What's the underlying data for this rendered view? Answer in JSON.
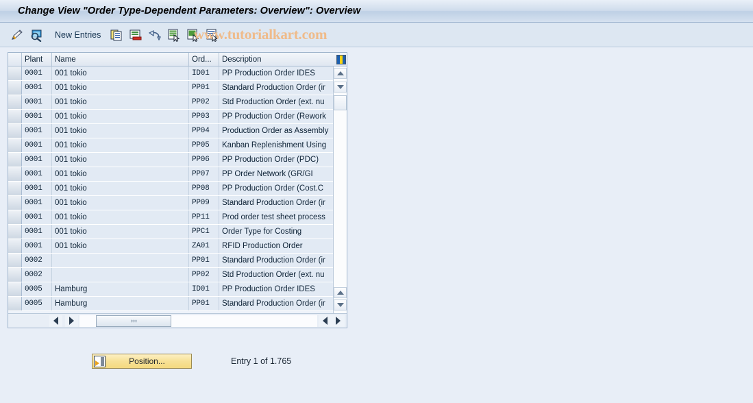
{
  "window": {
    "title": "Change View \"Order Type-Dependent Parameters: Overview\": Overview"
  },
  "watermark": {
    "text": "www.tutorialkart.com",
    "color": "#efbb8a"
  },
  "toolbar": {
    "new_entries_label": "New Entries",
    "icons": [
      {
        "name": "display-change-pencil-icon",
        "title": "Display/Change"
      },
      {
        "name": "check-entries-magnifier-icon",
        "title": "Check Entries"
      },
      {
        "name": "copy-as-icon",
        "title": "Copy As..."
      },
      {
        "name": "delete-icon",
        "title": "Delete"
      },
      {
        "name": "undo-icon",
        "title": "Undo Change"
      },
      {
        "name": "select-all-icon",
        "title": "Select All"
      },
      {
        "name": "select-block-icon",
        "title": "Select Block"
      },
      {
        "name": "deselect-all-icon",
        "title": "Deselect All"
      }
    ]
  },
  "table": {
    "columns": [
      {
        "key": "select",
        "label": ""
      },
      {
        "key": "plant",
        "label": "Plant"
      },
      {
        "key": "name",
        "label": "Name"
      },
      {
        "key": "ord",
        "label": "Ord..."
      },
      {
        "key": "description",
        "label": "Description"
      }
    ],
    "config_icon": "column-config-icon",
    "rows": [
      {
        "plant": "0001",
        "name": "001 tokio",
        "ord": "ID01",
        "description": "PP Production Order IDES"
      },
      {
        "plant": "0001",
        "name": "001 tokio",
        "ord": "PP01",
        "description": "Standard Production Order (ir"
      },
      {
        "plant": "0001",
        "name": "001 tokio",
        "ord": "PP02",
        "description": "Std Production Order (ext. nu"
      },
      {
        "plant": "0001",
        "name": "001 tokio",
        "ord": "PP03",
        "description": "PP Production Order (Rework"
      },
      {
        "plant": "0001",
        "name": "001 tokio",
        "ord": "PP04",
        "description": "Production Order as Assembly"
      },
      {
        "plant": "0001",
        "name": "001 tokio",
        "ord": "PP05",
        "description": "Kanban Replenishment Using "
      },
      {
        "plant": "0001",
        "name": "001 tokio",
        "ord": "PP06",
        "description": "PP Production Order (PDC)"
      },
      {
        "plant": "0001",
        "name": "001 tokio",
        "ord": "PP07",
        "description": "PP Order Network     (GR/GI"
      },
      {
        "plant": "0001",
        "name": "001 tokio",
        "ord": "PP08",
        "description": "PP Production Order  (Cost.C"
      },
      {
        "plant": "0001",
        "name": "001 tokio",
        "ord": "PP09",
        "description": "Standard Production Order (ir"
      },
      {
        "plant": "0001",
        "name": "001 tokio",
        "ord": "PP11",
        "description": "Prod order test sheet process"
      },
      {
        "plant": "0001",
        "name": "001 tokio",
        "ord": "PPC1",
        "description": "Order Type for Costing"
      },
      {
        "plant": "0001",
        "name": "001 tokio",
        "ord": "ZA01",
        "description": "RFID Production Order"
      },
      {
        "plant": "0002",
        "name": "",
        "ord": "PP01",
        "description": "Standard Production Order (ir"
      },
      {
        "plant": "0002",
        "name": "",
        "ord": "PP02",
        "description": "Std Production Order (ext. nu"
      },
      {
        "plant": "0005",
        "name": "Hamburg",
        "ord": "ID01",
        "description": "PP Production Order IDES"
      },
      {
        "plant": "0005",
        "name": "Hamburg",
        "ord": "PP01",
        "description": "Standard Production Order (ir"
      }
    ]
  },
  "footer": {
    "position_button_label": "Position...",
    "entry_count_text": "Entry 1 of 1.765"
  }
}
